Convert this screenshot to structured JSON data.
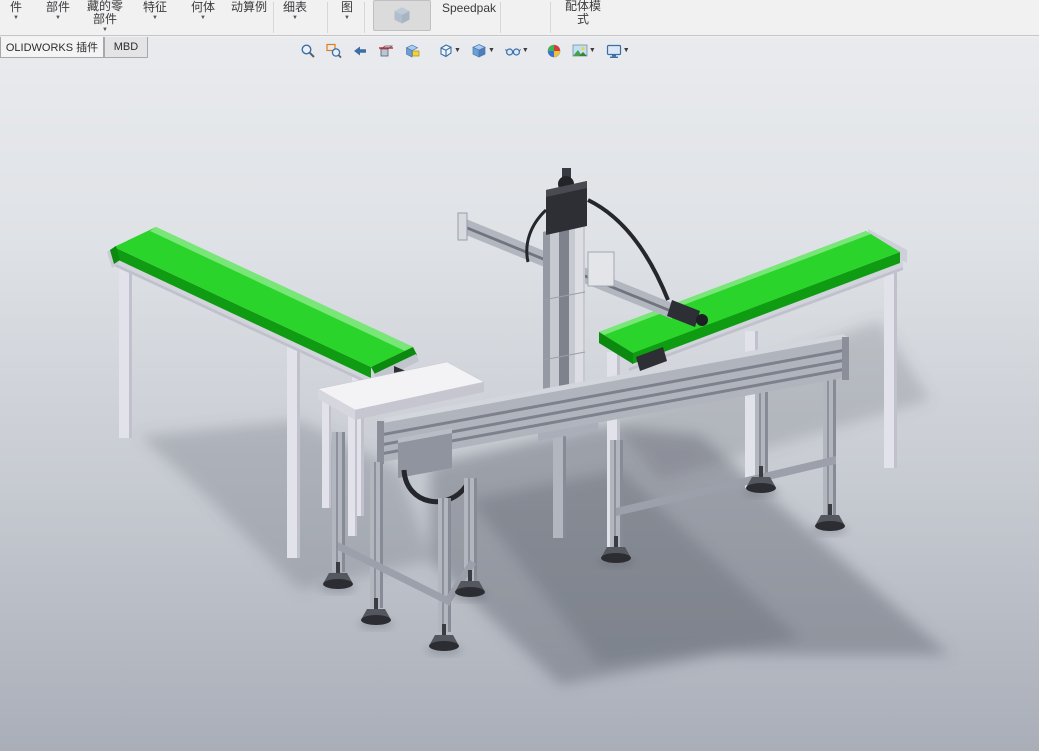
{
  "header": {
    "command_items": [
      {
        "label": "件",
        "has_arrow": true
      },
      {
        "label": "部件",
        "has_arrow": true
      },
      {
        "label": "藏的零部件",
        "has_arrow": true
      },
      {
        "label": "特征",
        "has_arrow": true
      },
      {
        "label": "何体",
        "has_arrow": true
      },
      {
        "label": "动算例",
        "has_arrow": false
      },
      {
        "label": "细表",
        "has_arrow": true
      },
      {
        "label": "图",
        "has_arrow": true
      },
      {
        "label": "Speedpak",
        "has_arrow": false
      },
      {
        "label": "配体模式",
        "has_arrow": false
      }
    ],
    "tabs": [
      {
        "label": "OLIDWORKS 插件"
      },
      {
        "label": "MBD"
      }
    ]
  },
  "view_toolbar": {
    "buttons": [
      {
        "name": "zoom-to-fit"
      },
      {
        "name": "zoom-to-area"
      },
      {
        "name": "previous-view"
      },
      {
        "name": "section-view"
      },
      {
        "name": "dynamic-annotation-views"
      },
      {
        "name": "view-orientation",
        "has_arrow": true
      },
      {
        "name": "display-style",
        "has_arrow": true
      },
      {
        "name": "hide-show-items",
        "has_arrow": true
      },
      {
        "name": "edit-appearance"
      },
      {
        "name": "apply-scene",
        "has_arrow": true
      },
      {
        "name": "view-settings",
        "has_arrow": true
      }
    ]
  },
  "scene": {
    "model_description": "Gantry pick-and-place robot on aluminium extrusion stand between two green belt conveyors, with white side table, shaded view on gradient grey background",
    "colors": {
      "belt_green": "#2bd42b",
      "belt_green_light": "#86ea86",
      "belt_green_dark": "#0f9c13",
      "belt_green_deep": "#0b8a0f",
      "frame_white": "#e2e3ea",
      "frame_shade": "#c0c1cc",
      "skirt": "#d2d4dc",
      "aluminum": "#b2b6bf",
      "aluminum_dark": "#878b95",
      "aluminum_slot": "#70747e",
      "beam_face": "#b0b4bd",
      "beam_top": "#d3d6dc",
      "motor_dark": "#2e2f35",
      "cable": "#26272d",
      "table_white": "#f3f3f6",
      "foot_dark": "#2c2d33",
      "foot_disc": "#55575f",
      "shadow": "#575c66",
      "bg_top": "#e9ebee",
      "bg_bottom": "#a9aeb8"
    }
  }
}
